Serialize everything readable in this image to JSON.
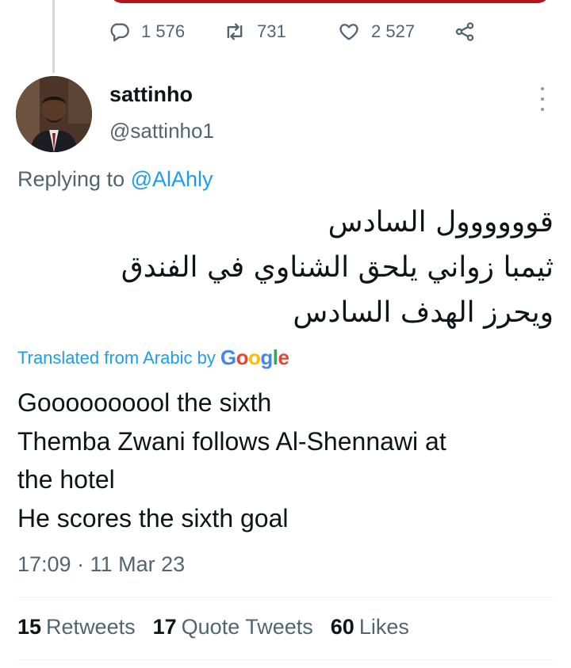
{
  "previous_tweet": {
    "reply_count": "1 576",
    "retweet_count": "731",
    "like_count": "2 527"
  },
  "tweet": {
    "display_name": "sattinho",
    "handle": "@sattinho1",
    "replying_prefix": "Replying to",
    "replying_to": "@AlAhly",
    "text_lines": [
      "قوووووول السادس",
      "ثيمبا زواني يلحق الشناوي في الفندق",
      "ويحرز الهدف السادس"
    ],
    "translated_label": "Translated from Arabic by",
    "translator": "Google",
    "translation_lines": [
      "Goooooooool the sixth",
      "Themba Zwani follows Al-Shennawi at",
      "the hotel",
      "He scores the sixth goal"
    ],
    "timestamp": "17:09 · 11 Mar 23"
  },
  "stats": {
    "retweets_count": "15",
    "retweets_label": "Retweets",
    "quotes_count": "17",
    "quotes_label": "Quote Tweets",
    "likes_count": "60",
    "likes_label": "Likes"
  },
  "colors": {
    "accent": "#1d9bf0",
    "secondary_text": "#536471",
    "primary_text": "#0f1419",
    "divider": "#eff3f4"
  },
  "icons": [
    "reply-icon",
    "retweet-icon",
    "like-icon",
    "share-icon",
    "more-options-icon"
  ]
}
